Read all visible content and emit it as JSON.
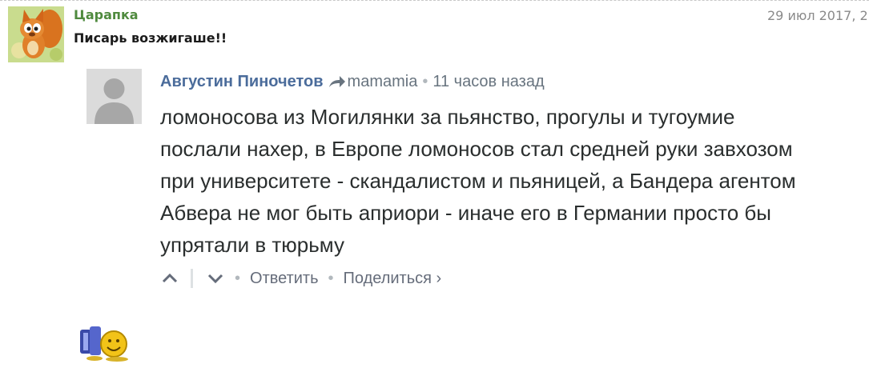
{
  "post": {
    "author": "Царапка",
    "date": "29 июл 2017, 2",
    "text": "Писарь возжигаше!!"
  },
  "quote": {
    "author": "Августин Пиночетов",
    "reply_to": "mamamia",
    "separator": "•",
    "time": "11 часов назад",
    "body_lines": [
      "ломоносова из Могилянки за пьянство, прогулы и тугоумие",
      "послали нахер, в Европе ломоносов стал средней руки завхозом",
      "при университете - скандалистом и пьяницей, а Бандера агентом",
      "Абвера не мог быть априори - иначе его в Германии просто бы",
      "упрятали в тюрьму"
    ],
    "actions": {
      "separator": "•",
      "reply": "Ответить",
      "share": "Поделиться ›"
    }
  },
  "colors": {
    "post_author": "#4f8a3e",
    "quote_author": "#4b6c9b",
    "meta_text": "#68747f",
    "body_text": "#2a2e2e"
  }
}
